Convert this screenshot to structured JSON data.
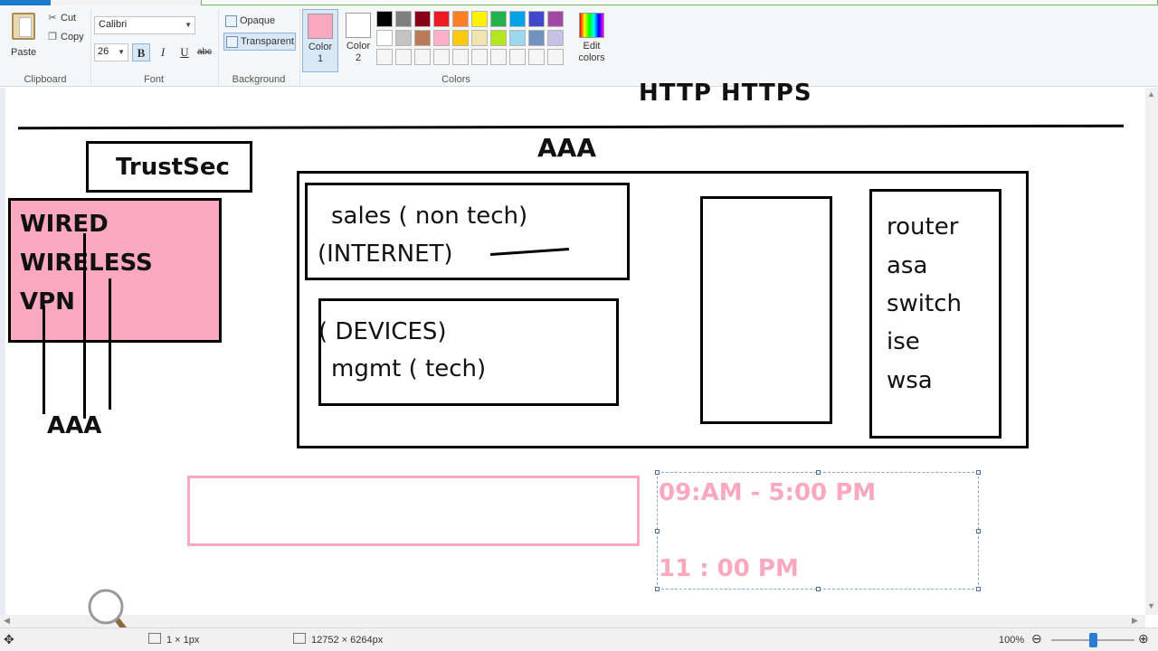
{
  "ribbon": {
    "clipboard": {
      "group_label": "Clipboard",
      "paste": "Paste",
      "cut": "Cut",
      "copy": "Copy"
    },
    "font": {
      "group_label": "Font",
      "family": "Calibri",
      "size": "26",
      "bold": "B",
      "italic": "I",
      "underline": "U",
      "strike": "abc"
    },
    "background": {
      "group_label": "Background",
      "opaque": "Opaque",
      "transparent": "Transparent"
    },
    "colors": {
      "group_label": "Colors",
      "color1_line1": "Color",
      "color1_line2": "1",
      "color1_value": "#f9a8c0",
      "color2_line1": "Color",
      "color2_line2": "2",
      "color2_value": "#ffffff",
      "edit_line1": "Edit",
      "edit_line2": "colors",
      "palette_row1": [
        "#000000",
        "#7f7f7f",
        "#880015",
        "#ed1c24",
        "#ff7f27",
        "#fff200",
        "#22b14c",
        "#00a2e8",
        "#3f48cc",
        "#a349a4"
      ],
      "palette_row2": [
        "#ffffff",
        "#c3c3c3",
        "#b97a57",
        "#ffaec9",
        "#ffc90e",
        "#efe4b0",
        "#b5e61d",
        "#99d9ea",
        "#7092be",
        "#c8bfe7"
      ],
      "palette_row3": [
        "#f5f5f5",
        "#f5f5f5",
        "#f5f5f5",
        "#f5f5f5",
        "#f5f5f5",
        "#f5f5f5",
        "#f5f5f5",
        "#f5f5f5",
        "#f5f5f5",
        "#f5f5f5"
      ]
    }
  },
  "canvas": {
    "heading": "HTTP HTTPS",
    "trustsec": "TrustSec",
    "aaa_top": "AAA",
    "wired": "WIRED",
    "wireless": "WIRELESS",
    "vpn": "VPN",
    "aaa_left": "AAA",
    "sales": "sales ( non tech)",
    "internet": "(INTERNET)",
    "devices": "( DEVICES)",
    "mgmt": "mgmt ( tech)",
    "router": "router",
    "asa": "asa",
    "switch": "switch",
    "ise": "ise",
    "wsa": "wsa",
    "time1": "09:AM -  5:00 PM",
    "time2": "11 : 00 PM",
    "accent_pink": "#f9a8c0"
  },
  "status": {
    "pen_size": "1 × 1px",
    "image_size": "12752 × 6264px",
    "zoom": "100%"
  }
}
